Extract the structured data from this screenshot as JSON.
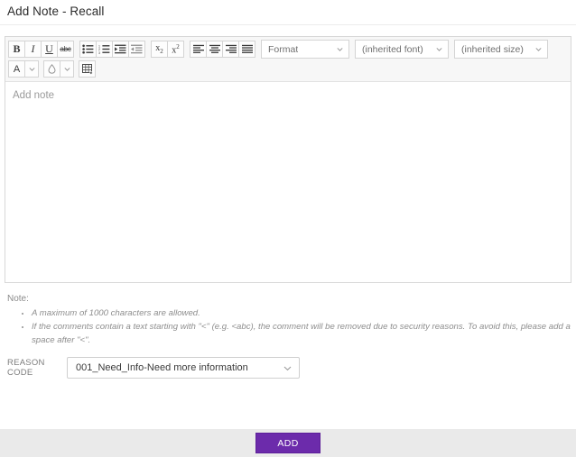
{
  "header": {
    "title": "Add Note - Recall"
  },
  "editor": {
    "placeholder": "Add note",
    "toolbar": {
      "row1": [
        {
          "name": "bold-button",
          "label": "B",
          "icon": "bold-icon"
        },
        {
          "name": "italic-button",
          "label": "I",
          "icon": "italic-icon"
        },
        {
          "name": "underline-button",
          "label": "U",
          "icon": "underline-icon"
        },
        {
          "name": "strikethrough-button",
          "label": "abc",
          "icon": "strikethrough-icon"
        },
        {
          "name": "bulleted-list-button",
          "label": "",
          "icon": "bulleted-list-icon"
        },
        {
          "name": "numbered-list-button",
          "label": "",
          "icon": "numbered-list-icon"
        },
        {
          "name": "increase-indent-button",
          "label": "",
          "icon": "increase-indent-icon"
        },
        {
          "name": "decrease-indent-button",
          "label": "",
          "icon": "decrease-indent-icon"
        },
        {
          "name": "subscript-button",
          "label": "x",
          "icon": "subscript-icon"
        },
        {
          "name": "superscript-button",
          "label": "x",
          "icon": "superscript-icon"
        },
        {
          "name": "align-left-button",
          "label": "",
          "icon": "align-left-icon"
        },
        {
          "name": "align-center-button",
          "label": "",
          "icon": "align-center-icon"
        },
        {
          "name": "align-right-button",
          "label": "",
          "icon": "align-right-icon"
        },
        {
          "name": "align-justify-button",
          "label": "",
          "icon": "align-justify-icon"
        }
      ],
      "selects": {
        "format": "Format",
        "font": "(inherited font)",
        "size": "(inherited size)"
      },
      "row2": [
        {
          "name": "text-color-button",
          "label": "A",
          "icon": "text-color-icon"
        },
        {
          "name": "text-color-dropdown",
          "label": "",
          "icon": "chevron-down-icon"
        },
        {
          "name": "background-color-button",
          "label": "",
          "icon": "background-color-droplet-icon"
        },
        {
          "name": "background-color-dropdown",
          "label": "",
          "icon": "chevron-down-icon"
        },
        {
          "name": "insert-table-button",
          "label": "",
          "icon": "table-icon"
        }
      ]
    }
  },
  "note": {
    "label": "Note:",
    "items": [
      "A maximum of 1000 characters are allowed.",
      "If the comments contain a text starting with \"<\" (e.g. <abc), the comment will be removed due to security reasons. To avoid this, please add a space after \"<\"."
    ]
  },
  "reason": {
    "label": "REASON CODE",
    "selected": "001_Need_Info-Need more information"
  },
  "footer": {
    "add_label": "ADD"
  },
  "colors": {
    "accent": "#6c2bab",
    "footer_bg": "#eaeaea",
    "toolbar_bg": "#f7f7f7",
    "border": "#d8d8d8"
  }
}
